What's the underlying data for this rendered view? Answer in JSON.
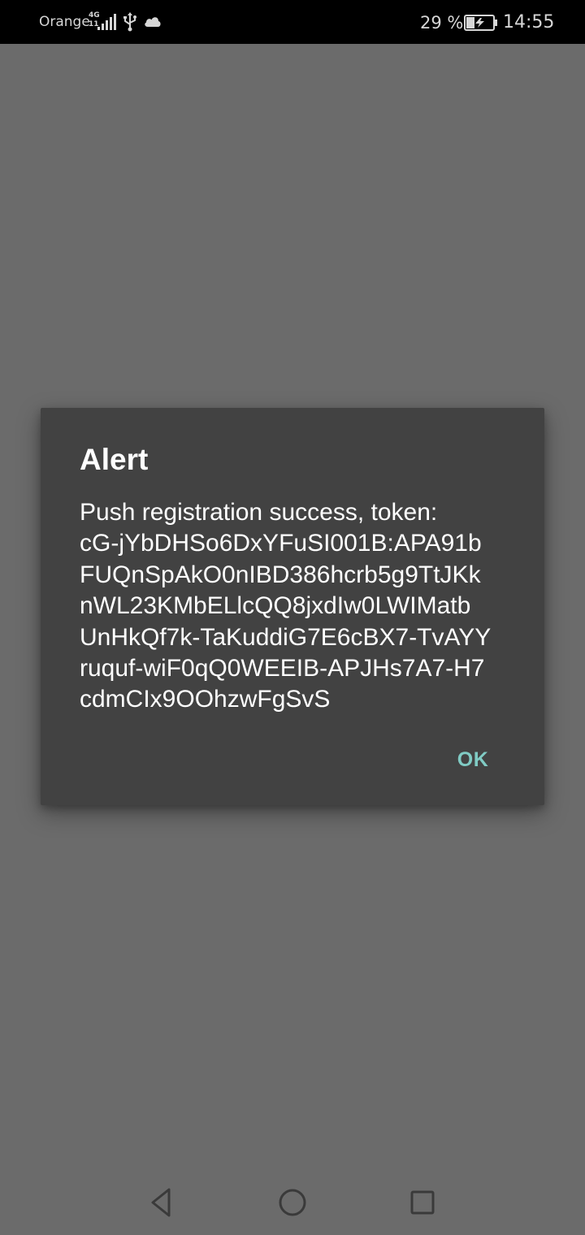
{
  "status_bar": {
    "carrier": "Orange",
    "network_type": "4G",
    "network_sub": "11",
    "battery_percent": "29 %",
    "time": "14:55",
    "icons": [
      "signal-icon",
      "usb-icon",
      "cloud-icon",
      "battery-charging-icon"
    ]
  },
  "dialog": {
    "title": "Alert",
    "message_lines": [
      "Push registration success, token:",
      "cG-jYbDHSo6DxYFuSI001B:APA91b",
      "FUQnSpAkO0nIBD386hcrb5g9TtJKk",
      "nWL23KMbELlcQQ8jxdIw0LWIMatb",
      "UnHkQf7k-TaKuddiG7E6cBX7-TvAYY",
      "ruquf-wiF0qQ0WEEIB-APJHs7A7-H7",
      "cdmCIx9OOhzwFgSvS"
    ],
    "ok_label": "OK"
  },
  "nav_bar": {
    "icons": [
      "back-icon",
      "home-icon",
      "recents-icon"
    ]
  },
  "colors": {
    "scrim": "#6b6b6b",
    "dialog_bg": "#424242",
    "accent": "#80cbc4",
    "status_bar": "#000000"
  }
}
